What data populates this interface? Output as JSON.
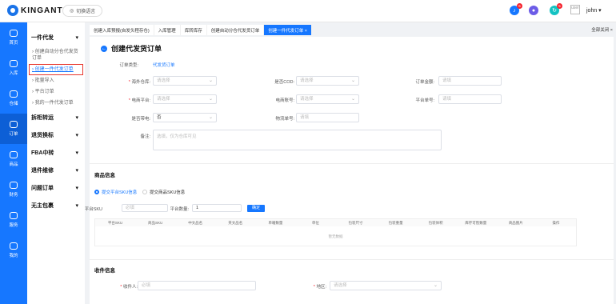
{
  "app": {
    "brand": "KINGANT",
    "language_button": "切换语言",
    "user": "john",
    "avatar_alt": "user"
  },
  "top_icons": [
    {
      "name": "bell-icon",
      "badge": "6",
      "color": "#1677ff"
    },
    {
      "name": "chat-icon",
      "badge": "",
      "color": "#6c5ce7"
    },
    {
      "name": "refresh-icon",
      "badge": "5",
      "color": "#13c2c2"
    }
  ],
  "sidebar": [
    {
      "label": "首页",
      "icon": "home-icon"
    },
    {
      "label": "入库",
      "icon": "inbound-icon"
    },
    {
      "label": "仓储",
      "icon": "warehouse-icon"
    },
    {
      "label": "订单",
      "icon": "order-icon"
    },
    {
      "label": "商品",
      "icon": "product-icon"
    },
    {
      "label": "财务",
      "icon": "finance-icon"
    },
    {
      "label": "服务",
      "icon": "service-icon"
    },
    {
      "label": "我的",
      "icon": "user-icon"
    }
  ],
  "nav": {
    "group1": "一件代发",
    "sub": [
      "创建自动分仓代发货订单",
      "创建一件代发订单",
      "批量导入",
      "平台订单",
      "我的一件代发订单"
    ],
    "groups": [
      "拆柜转运",
      "退货换标",
      "FBA中转",
      "退件维修",
      "问题订单",
      "无主包裹"
    ]
  },
  "tabs": [
    "创建入库预报(自发头程存仓)",
    "入库管理",
    "库转库存",
    "创建自动分仓代发货订单",
    "创建一件代发订单 ×"
  ],
  "close_all": "全部关闭 ×",
  "page_title": "创建代发货订单",
  "form": {
    "order_type_label": "订单类型:",
    "order_type_value": "代发货订单",
    "overseas_wh_label": "海外仓库:",
    "overseas_wh_ph": "请选择",
    "cod_label": "是否COD:",
    "cod_ph": "请选择",
    "order_amount_label": "订单金额:",
    "order_amount_ph": "请填",
    "ec_platform_label": "电商平台:",
    "ec_platform_ph": "请选择",
    "ec_account_label": "电商账号:",
    "ec_account_ph": "请选择",
    "platform_no_label": "平台单号:",
    "platform_no_ph": "请填",
    "bulky_label": "是否带电:",
    "bulky_value": "否",
    "tracking_label": "物流单号:",
    "tracking_ph": "请填",
    "remark_label": "备注:",
    "remark_ph": "选填，仅为仓库可见"
  },
  "product_section": {
    "title": "商品信息",
    "radio_on": "提交平台SKU信息",
    "radio_off": "提交商品SKU信息",
    "sku_label": "平台SKU",
    "sku_ph": "必填",
    "qty_label": "平台数量:",
    "qty_value": "1",
    "confirm": "确定",
    "columns": [
      "平台SKU",
      "商品SKU",
      "中文品名",
      "英文品名",
      "单箱数量",
      "单位",
      "包装尺寸",
      "包装重量",
      "包装体积",
      "库存可售数量",
      "商品图片",
      "操作"
    ],
    "empty": "暂无数据"
  },
  "receiver_section": {
    "title": "收件信息",
    "name_label": "收件人:",
    "name_ph": "必填",
    "region_label": "地区:",
    "region_ph": "请选择"
  }
}
